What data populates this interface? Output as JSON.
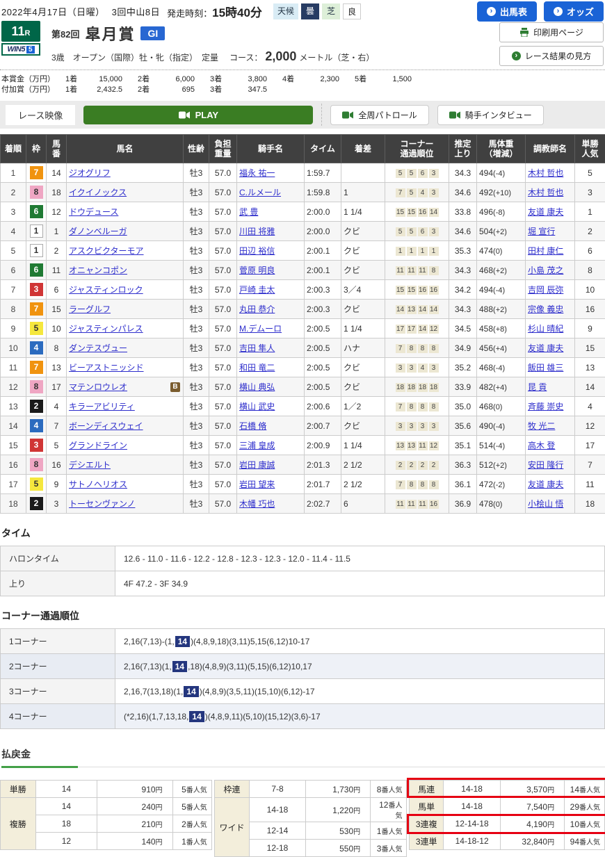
{
  "colors": {
    "accent_blue": "#1a63d6",
    "race_number_green": "#006648",
    "grade_blue": "#2767d2",
    "header_bg": "#404040",
    "play_green": "#3a7d23",
    "highlight_navy": "#24367e",
    "red_box": "#e60012",
    "payout_label_beige": "#f3eedb",
    "corner_cell_beige": "#ece7d2",
    "frame_colors": {
      "1": "#ffffff",
      "2": "#1a1a1a",
      "3": "#d03535",
      "4": "#2b6bbf",
      "5": "#f5e73d",
      "6": "#1f7a33",
      "7": "#f0930f",
      "8": "#efa6c3"
    }
  },
  "header": {
    "date": "2022年4月17日（日曜）",
    "meeting": "3回中山8日",
    "start_label": "発走時刻：",
    "start_time": "15時40分",
    "weather_label": "天候",
    "weather_value": "曇",
    "turf_label": "芝",
    "turf_value": "良",
    "entry_button": "出馬表",
    "odds_button": "オッズ",
    "print_button": "印刷用ページ",
    "guide_button": "レース結果の見方",
    "arrow_glyph": "›"
  },
  "race": {
    "number": "11",
    "number_suffix": "R",
    "win5": "WIN5",
    "win5_num": "5",
    "edition": "第82回",
    "name": "皐月賞",
    "grade": "GI",
    "conditions": "3歳　オープン（国際）牡・牝（指定）　定量",
    "course_label": "コース：",
    "course_value": "2,000",
    "course_suffix": "メートル（芝・右）"
  },
  "prize": {
    "main_label": "本賞金（万円）",
    "main": [
      [
        "1着",
        "15,000"
      ],
      [
        "2着",
        "6,000"
      ],
      [
        "3着",
        "3,800"
      ],
      [
        "4着",
        "2,300"
      ],
      [
        "5着",
        "1,500"
      ]
    ],
    "added_label": "付加賞（万円）",
    "added": [
      [
        "1着",
        "2,432.5"
      ],
      [
        "2着",
        "695"
      ],
      [
        "3着",
        "347.5"
      ]
    ]
  },
  "video": {
    "label": "レース映像",
    "play": "PLAY",
    "patrol": "全周パトロール",
    "interview": "騎手インタビュー"
  },
  "results": {
    "columns": [
      "着順",
      "枠",
      "馬\n番",
      "馬名",
      "性齢",
      "負担\n重量",
      "騎手名",
      "タイム",
      "着差",
      "コーナー\n通過順位",
      "推定\n上り",
      "馬体重\n（増減）",
      "調教師名",
      "単勝\n人気"
    ],
    "rows": [
      {
        "pos": "1",
        "frame": 7,
        "num": "14",
        "name": "ジオグリフ",
        "b": false,
        "sa": "牡3",
        "wt": "57.0",
        "jockey": "福永 祐一",
        "time": "1:59.7",
        "margin": "",
        "corners": [
          "5",
          "5",
          "6",
          "3"
        ],
        "up": "34.3",
        "hw": "494",
        "hwd": "(-4)",
        "trainer": "木村 哲也",
        "pop": "5"
      },
      {
        "pos": "2",
        "frame": 8,
        "num": "18",
        "name": "イクイノックス",
        "b": false,
        "sa": "牡3",
        "wt": "57.0",
        "jockey": "C.ルメール",
        "time": "1:59.8",
        "margin": "1",
        "corners": [
          "7",
          "5",
          "4",
          "3"
        ],
        "up": "34.6",
        "hw": "492",
        "hwd": "(+10)",
        "trainer": "木村 哲也",
        "pop": "3"
      },
      {
        "pos": "3",
        "frame": 6,
        "num": "12",
        "name": "ドウデュース",
        "b": false,
        "sa": "牡3",
        "wt": "57.0",
        "jockey": "武 豊",
        "time": "2:00.0",
        "margin": "1 1/4",
        "corners": [
          "15",
          "15",
          "16",
          "14"
        ],
        "up": "33.8",
        "hw": "496",
        "hwd": "(-8)",
        "trainer": "友道 康夫",
        "pop": "1"
      },
      {
        "pos": "4",
        "frame": 1,
        "num": "1",
        "name": "ダノンベルーガ",
        "b": false,
        "sa": "牡3",
        "wt": "57.0",
        "jockey": "川田 将雅",
        "time": "2:00.0",
        "margin": "クビ",
        "corners": [
          "5",
          "5",
          "6",
          "3"
        ],
        "up": "34.6",
        "hw": "504",
        "hwd": "(+2)",
        "trainer": "堀 宣行",
        "pop": "2"
      },
      {
        "pos": "5",
        "frame": 1,
        "num": "2",
        "name": "アスクビクターモア",
        "b": false,
        "sa": "牡3",
        "wt": "57.0",
        "jockey": "田辺 裕信",
        "time": "2:00.1",
        "margin": "クビ",
        "corners": [
          "1",
          "1",
          "1",
          "1"
        ],
        "up": "35.3",
        "hw": "474",
        "hwd": "(0)",
        "trainer": "田村 康仁",
        "pop": "6"
      },
      {
        "pos": "6",
        "frame": 6,
        "num": "11",
        "name": "オニャンコポン",
        "b": false,
        "sa": "牡3",
        "wt": "57.0",
        "jockey": "菅原 明良",
        "time": "2:00.1",
        "margin": "クビ",
        "corners": [
          "11",
          "11",
          "11",
          "8"
        ],
        "up": "34.3",
        "hw": "468",
        "hwd": "(+2)",
        "trainer": "小島 茂之",
        "pop": "8"
      },
      {
        "pos": "7",
        "frame": 3,
        "num": "6",
        "name": "ジャスティンロック",
        "b": false,
        "sa": "牡3",
        "wt": "57.0",
        "jockey": "戸崎 圭太",
        "time": "2:00.3",
        "margin": "3／4",
        "corners": [
          "15",
          "15",
          "16",
          "16"
        ],
        "up": "34.2",
        "hw": "494",
        "hwd": "(-4)",
        "trainer": "吉岡 辰弥",
        "pop": "10"
      },
      {
        "pos": "8",
        "frame": 7,
        "num": "15",
        "name": "ラーグルフ",
        "b": false,
        "sa": "牡3",
        "wt": "57.0",
        "jockey": "丸田 恭介",
        "time": "2:00.3",
        "margin": "クビ",
        "corners": [
          "14",
          "13",
          "14",
          "14"
        ],
        "up": "34.3",
        "hw": "488",
        "hwd": "(+2)",
        "trainer": "宗像 義忠",
        "pop": "16"
      },
      {
        "pos": "9",
        "frame": 5,
        "num": "10",
        "name": "ジャスティンパレス",
        "b": false,
        "sa": "牡3",
        "wt": "57.0",
        "jockey": "M.デムーロ",
        "time": "2:00.5",
        "margin": "1 1/4",
        "corners": [
          "17",
          "17",
          "14",
          "12"
        ],
        "up": "34.5",
        "hw": "458",
        "hwd": "(+8)",
        "trainer": "杉山 晴紀",
        "pop": "9"
      },
      {
        "pos": "10",
        "frame": 4,
        "num": "8",
        "name": "ダンテスヴュー",
        "b": false,
        "sa": "牡3",
        "wt": "57.0",
        "jockey": "吉田 隼人",
        "time": "2:00.5",
        "margin": "ハナ",
        "corners": [
          "7",
          "8",
          "8",
          "8"
        ],
        "up": "34.9",
        "hw": "456",
        "hwd": "(+4)",
        "trainer": "友道 康夫",
        "pop": "15"
      },
      {
        "pos": "11",
        "frame": 7,
        "num": "13",
        "name": "ビーアストニッシド",
        "b": false,
        "sa": "牡3",
        "wt": "57.0",
        "jockey": "和田 竜二",
        "time": "2:00.5",
        "margin": "クビ",
        "corners": [
          "3",
          "3",
          "4",
          "3"
        ],
        "up": "35.2",
        "hw": "468",
        "hwd": "(-4)",
        "trainer": "飯田 雄三",
        "pop": "13"
      },
      {
        "pos": "12",
        "frame": 8,
        "num": "17",
        "name": "マテンロウレオ",
        "b": true,
        "sa": "牡3",
        "wt": "57.0",
        "jockey": "横山 典弘",
        "time": "2:00.5",
        "margin": "クビ",
        "corners": [
          "18",
          "18",
          "18",
          "18"
        ],
        "up": "33.9",
        "hw": "482",
        "hwd": "(+4)",
        "trainer": "昆 貢",
        "pop": "14"
      },
      {
        "pos": "13",
        "frame": 2,
        "num": "4",
        "name": "キラーアビリティ",
        "b": false,
        "sa": "牡3",
        "wt": "57.0",
        "jockey": "横山 武史",
        "time": "2:00.6",
        "margin": "1／2",
        "corners": [
          "7",
          "8",
          "8",
          "8"
        ],
        "up": "35.0",
        "hw": "468",
        "hwd": "(0)",
        "trainer": "斉藤 崇史",
        "pop": "4"
      },
      {
        "pos": "14",
        "frame": 4,
        "num": "7",
        "name": "ボーンディスウェイ",
        "b": false,
        "sa": "牡3",
        "wt": "57.0",
        "jockey": "石橋 脩",
        "time": "2:00.7",
        "margin": "クビ",
        "corners": [
          "3",
          "3",
          "3",
          "3"
        ],
        "up": "35.6",
        "hw": "490",
        "hwd": "(-4)",
        "trainer": "牧 光二",
        "pop": "12"
      },
      {
        "pos": "15",
        "frame": 3,
        "num": "5",
        "name": "グランドライン",
        "b": false,
        "sa": "牡3",
        "wt": "57.0",
        "jockey": "三浦 皇成",
        "time": "2:00.9",
        "margin": "1 1/4",
        "corners": [
          "13",
          "13",
          "11",
          "12"
        ],
        "up": "35.1",
        "hw": "514",
        "hwd": "(-4)",
        "trainer": "高木 登",
        "pop": "17"
      },
      {
        "pos": "16",
        "frame": 8,
        "num": "16",
        "name": "デシエルト",
        "b": false,
        "sa": "牡3",
        "wt": "57.0",
        "jockey": "岩田 康誠",
        "time": "2:01.3",
        "margin": "2 1/2",
        "corners": [
          "2",
          "2",
          "2",
          "2"
        ],
        "up": "36.3",
        "hw": "512",
        "hwd": "(+2)",
        "trainer": "安田 隆行",
        "pop": "7"
      },
      {
        "pos": "17",
        "frame": 5,
        "num": "9",
        "name": "サトノヘリオス",
        "b": false,
        "sa": "牡3",
        "wt": "57.0",
        "jockey": "岩田 望来",
        "time": "2:01.7",
        "margin": "2 1/2",
        "corners": [
          "7",
          "8",
          "8",
          "8"
        ],
        "up": "36.1",
        "hw": "472",
        "hwd": "(-2)",
        "trainer": "友道 康夫",
        "pop": "11"
      },
      {
        "pos": "18",
        "frame": 2,
        "num": "3",
        "name": "トーセンヴァンノ",
        "b": false,
        "sa": "牡3",
        "wt": "57.0",
        "jockey": "木幡 巧也",
        "time": "2:02.7",
        "margin": "6",
        "corners": [
          "11",
          "11",
          "11",
          "16"
        ],
        "up": "36.9",
        "hw": "478",
        "hwd": "(0)",
        "trainer": "小桧山 悟",
        "pop": "18"
      }
    ]
  },
  "time_section": {
    "heading": "タイム",
    "rows": [
      [
        "ハロンタイム",
        "12.6 - 11.0 - 11.6 - 12.2 - 12.8 - 12.3 - 12.3 - 12.0 - 11.4 - 11.5"
      ],
      [
        "上り",
        "4F 47.2 - 3F 34.9"
      ]
    ]
  },
  "corner_section": {
    "heading": "コーナー通過順位",
    "rows": [
      {
        "label": "1コーナー",
        "before": "2,16(7,13)-(1,",
        "highlight": "14",
        "after": ")(4,8,9,18)(3,11)5,15(6,12)10-17"
      },
      {
        "label": "2コーナー",
        "before": "2,16(7,13)(1,",
        "highlight": "14",
        "after": ",18)(4,8,9)(3,11)(5,15)(6,12)10,17"
      },
      {
        "label": "3コーナー",
        "before": "2,16,7(13,18)(1,",
        "highlight": "14",
        "after": ")(4,8,9)(3,5,11)(15,10)(6,12)-17"
      },
      {
        "label": "4コーナー",
        "before": "(*2,16)(1,7,13,18,",
        "highlight": "14",
        "after": ")(4,8,9,11)(5,10)(15,12)(3,6)-17"
      }
    ]
  },
  "payout": {
    "heading": "払戻金",
    "unit": "円",
    "pop_suffix": "番人気",
    "groups": [
      {
        "rows": [
          {
            "label": "単勝",
            "span": 1,
            "combo": "14",
            "amount": "910",
            "pop": "5",
            "highlight": false
          },
          {
            "label": "複勝",
            "span": 3,
            "combo": "14",
            "amount": "240",
            "pop": "5",
            "highlight": false
          },
          {
            "combo": "18",
            "amount": "210",
            "pop": "2",
            "highlight": false,
            "dash": true
          },
          {
            "combo": "12",
            "amount": "140",
            "pop": "1",
            "highlight": false,
            "dash": true
          }
        ]
      },
      {
        "rows": [
          {
            "label": "枠連",
            "span": 1,
            "combo": "7-8",
            "amount": "1,730",
            "pop": "8",
            "highlight": false
          },
          {
            "label": "ワイド",
            "span": 3,
            "combo": "14-18",
            "amount": "1,220",
            "pop": "12",
            "highlight": false
          },
          {
            "combo": "12-14",
            "amount": "530",
            "pop": "1",
            "highlight": false,
            "dash": true
          },
          {
            "combo": "12-18",
            "amount": "550",
            "pop": "3",
            "highlight": false,
            "dash": true
          }
        ]
      },
      {
        "rows": [
          {
            "label": "馬連",
            "span": 1,
            "combo": "14-18",
            "amount": "3,570",
            "pop": "14",
            "highlight": true
          },
          {
            "label": "馬単",
            "span": 1,
            "combo": "14-18",
            "amount": "7,540",
            "pop": "29",
            "highlight": false
          },
          {
            "label": "3連複",
            "span": 1,
            "combo": "12-14-18",
            "amount": "4,190",
            "pop": "10",
            "highlight": true
          },
          {
            "label": "3連単",
            "span": 1,
            "combo": "14-18-12",
            "amount": "32,840",
            "pop": "94",
            "highlight": false
          }
        ]
      }
    ]
  }
}
